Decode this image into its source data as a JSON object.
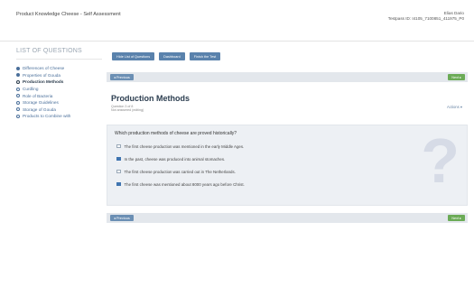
{
  "header": {
    "title": "Product Knowledge Cheese - Self Assessment",
    "user_name": "Elias Dario",
    "user_id": "Testpass ID: I4105_7100851_411975_P0"
  },
  "sidebar": {
    "heading": "LIST OF QUESTIONS",
    "items": [
      {
        "label": "Differences of Cheese",
        "state": "done"
      },
      {
        "label": "Properties of Gouda",
        "state": "done"
      },
      {
        "label": "Production Methods",
        "state": "current"
      },
      {
        "label": "Curdling",
        "state": "open"
      },
      {
        "label": "Role of Bacteria",
        "state": "open"
      },
      {
        "label": "Storage Guidelines",
        "state": "open"
      },
      {
        "label": "Storage of Gouda",
        "state": "open"
      },
      {
        "label": "Products to Combine with",
        "state": "open"
      }
    ]
  },
  "toolbar": {
    "list_label": "Hide List of Questions",
    "dashboard_label": "Dashboard",
    "finish_label": "Finish the Test"
  },
  "nav": {
    "prev_label": "◂ Previous",
    "next_label": "Next ▸"
  },
  "question": {
    "title": "Production Methods",
    "counter": "Question 3 of 8",
    "status": "Not answered (editing)",
    "actions_label": "Actions ▾",
    "text": "Which production methods of cheese are proved historically?",
    "options": [
      {
        "label": "The first cheese production was mentioned in the early Middle Ages.",
        "checked": false
      },
      {
        "label": "In the past, cheese was produced into animal stomaches.",
        "checked": true
      },
      {
        "label": "The first cheese production was carried out in The Netherlands.",
        "checked": false
      },
      {
        "label": "The first cheese was mentioned about 8000 years ago before Christ.",
        "checked": true
      }
    ]
  },
  "colors": {
    "accent_blue": "#5a82ac",
    "next_green": "#6bab56",
    "checked": "#3f74b0"
  }
}
